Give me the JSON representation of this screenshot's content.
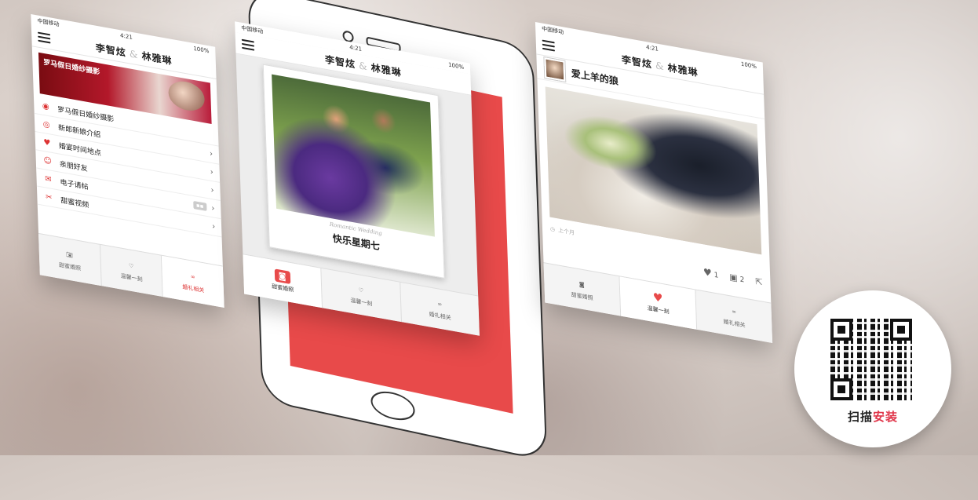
{
  "status": {
    "carrier": "中国移动",
    "time": "4:21",
    "battery": "100%"
  },
  "couple": {
    "groom": "李智炫",
    "amp": "&",
    "bride": "林雅琳"
  },
  "screen1": {
    "banner_text": "罗马假日婚纱摄影",
    "items": [
      {
        "icon": "camera-ring-icon",
        "label": "罗马假日婚纱摄影"
      },
      {
        "icon": "rings-icon",
        "label": "新郎新娘介绍"
      },
      {
        "icon": "calendar-heart-icon",
        "label": "婚宴时间地点"
      },
      {
        "icon": "friends-icon",
        "label": "亲朋好友"
      },
      {
        "icon": "envelope-icon",
        "label": "电子请帖"
      },
      {
        "icon": "video-icon",
        "label": "甜蜜视频"
      }
    ]
  },
  "screen2": {
    "script_text": "Romantic Wedding",
    "caption": "快乐星期七"
  },
  "screen3": {
    "author": "爱上羊的狼",
    "time_ago": "上个月",
    "likes": "1",
    "comments": "2"
  },
  "tabs": [
    {
      "label": "甜蜜婚照"
    },
    {
      "label": "温馨一刻"
    },
    {
      "label": "婚礼相关"
    }
  ],
  "qr": {
    "label_dark": "扫描",
    "label_red": "安装"
  },
  "colors": {
    "accent": "#e84a4a",
    "qr_red": "#e0364a"
  }
}
